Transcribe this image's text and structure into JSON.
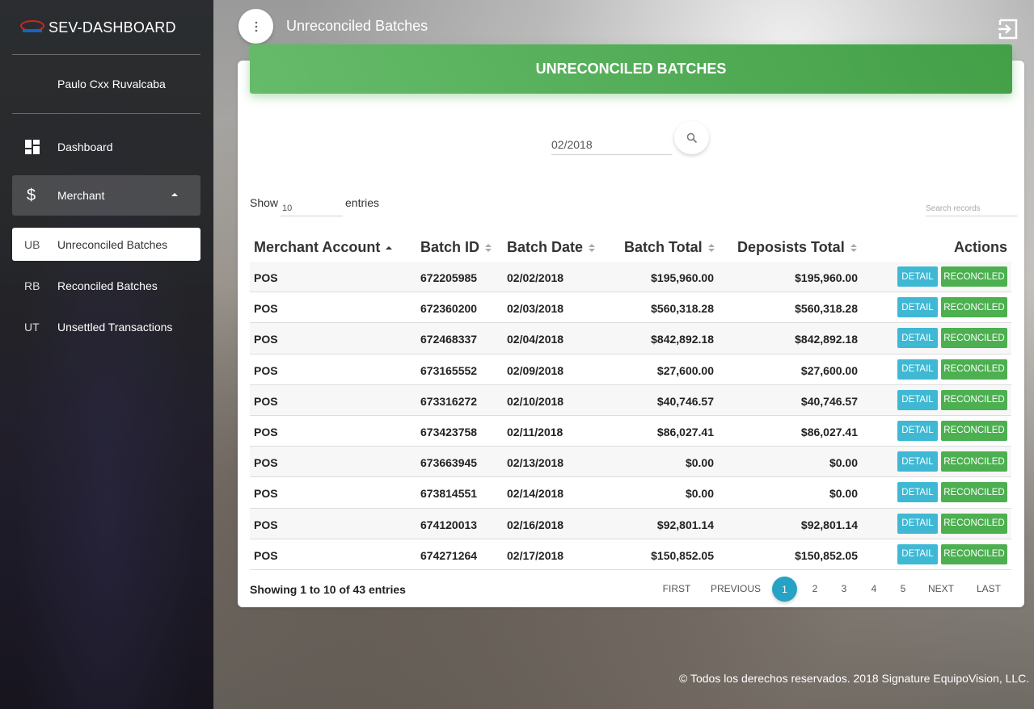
{
  "app": {
    "brand_title": "SEV-DASHBOARD",
    "user_name": "Paulo Cxx Ruvalcaba"
  },
  "sidebar": {
    "items": [
      {
        "icon": "dashboard-icon",
        "label": "Dashboard"
      },
      {
        "icon": "dollar-icon",
        "label": "Merchant"
      }
    ],
    "sub_items": [
      {
        "abbr": "UB",
        "label": "Unreconciled Batches"
      },
      {
        "abbr": "RB",
        "label": "Reconciled Batches"
      },
      {
        "abbr": "UT",
        "label": "Unsettled Transactions"
      }
    ]
  },
  "topbar": {
    "title": "Unreconciled Batches"
  },
  "card": {
    "header": "UNRECONCILED BATCHES",
    "date_value": "02/2018",
    "show_label": "Show",
    "show_value": "10",
    "entries_label": "entries",
    "search_placeholder": "Search records"
  },
  "table": {
    "columns": [
      "Merchant Account",
      "Batch ID",
      "Batch Date",
      "Batch Total",
      "Deposists Total",
      "Actions"
    ],
    "detail_label": "DETAIL",
    "reconciled_label": "RECONCILED",
    "rows": [
      {
        "account": "POS",
        "batch_id": "672205985",
        "date": "02/02/2018",
        "total": "$195,960.00",
        "deposits": "$195,960.00"
      },
      {
        "account": "POS",
        "batch_id": "672360200",
        "date": "02/03/2018",
        "total": "$560,318.28",
        "deposits": "$560,318.28"
      },
      {
        "account": "POS",
        "batch_id": "672468337",
        "date": "02/04/2018",
        "total": "$842,892.18",
        "deposits": "$842,892.18"
      },
      {
        "account": "POS",
        "batch_id": "673165552",
        "date": "02/09/2018",
        "total": "$27,600.00",
        "deposits": "$27,600.00"
      },
      {
        "account": "POS",
        "batch_id": "673316272",
        "date": "02/10/2018",
        "total": "$40,746.57",
        "deposits": "$40,746.57"
      },
      {
        "account": "POS",
        "batch_id": "673423758",
        "date": "02/11/2018",
        "total": "$86,027.41",
        "deposits": "$86,027.41"
      },
      {
        "account": "POS",
        "batch_id": "673663945",
        "date": "02/13/2018",
        "total": "$0.00",
        "deposits": "$0.00"
      },
      {
        "account": "POS",
        "batch_id": "673814551",
        "date": "02/14/2018",
        "total": "$0.00",
        "deposits": "$0.00"
      },
      {
        "account": "POS",
        "batch_id": "674120013",
        "date": "02/16/2018",
        "total": "$92,801.14",
        "deposits": "$92,801.14"
      },
      {
        "account": "POS",
        "batch_id": "674271264",
        "date": "02/17/2018",
        "total": "$150,852.05",
        "deposits": "$150,852.05"
      }
    ]
  },
  "pagination": {
    "info": "Showing 1 to 10 of 43 entries",
    "first": "FIRST",
    "previous": "PREVIOUS",
    "pages": [
      "1",
      "2",
      "3",
      "4",
      "5"
    ],
    "next": "NEXT",
    "last": "LAST"
  },
  "footer": {
    "copyright": "© Todos los derechos reservados. 2018 Signature EquipoVision, LLC."
  },
  "colors": {
    "header_green": "#4caf50",
    "detail_blue": "#3fb8d4",
    "active_page": "#26a2c4"
  }
}
